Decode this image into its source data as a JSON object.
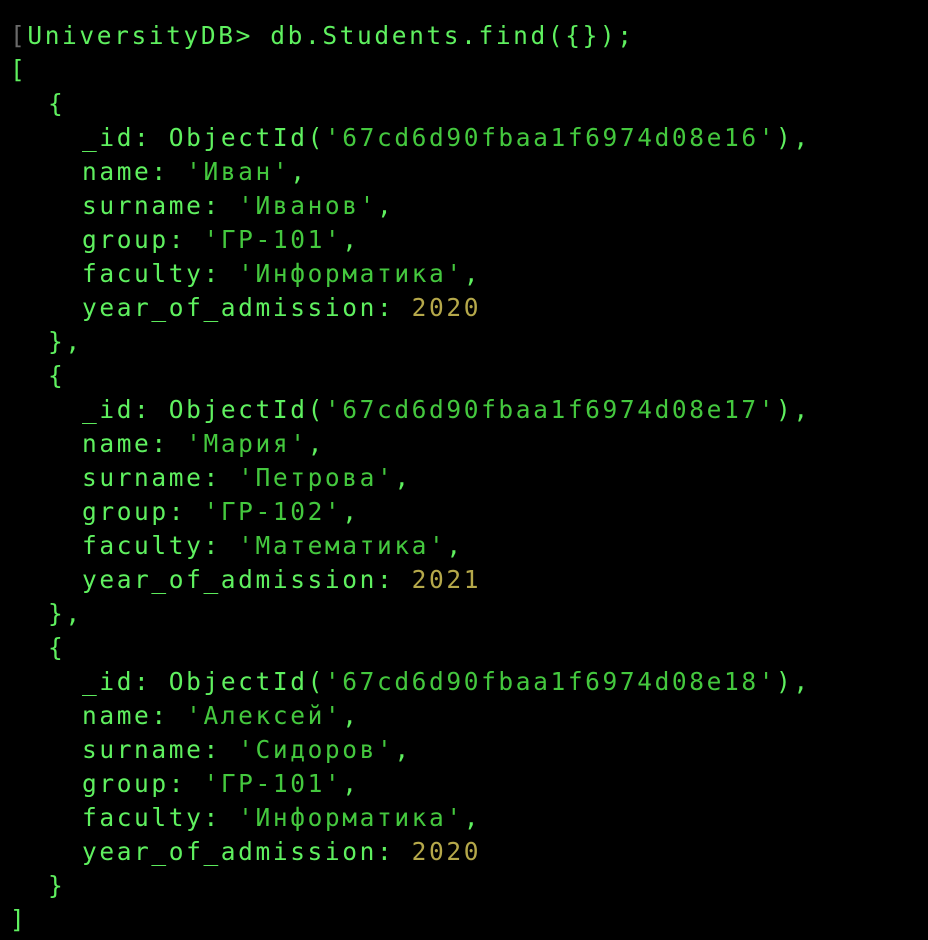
{
  "prompt": {
    "database": "UniversityDB",
    "symbol": ">",
    "command": "db.Students.find({});"
  },
  "output": {
    "open_array": "[",
    "close_array": "]",
    "documents": [
      {
        "_id": "67cd6d90fbaa1f6974d08e16",
        "name": "Иван",
        "surname": "Иванов",
        "group": "ГР-101",
        "faculty": "Информатика",
        "year_of_admission": "2020"
      },
      {
        "_id": "67cd6d90fbaa1f6974d08e17",
        "name": "Мария",
        "surname": "Петрова",
        "group": "ГР-102",
        "faculty": "Математика",
        "year_of_admission": "2021"
      },
      {
        "_id": "67cd6d90fbaa1f6974d08e18",
        "name": "Алексей",
        "surname": "Сидоров",
        "group": "ГР-101",
        "faculty": "Информатика",
        "year_of_admission": "2020"
      }
    ]
  },
  "colors": {
    "background": "#000000",
    "text": "#5ff05f",
    "string": "#44c83e",
    "number": "#b5a84a"
  }
}
